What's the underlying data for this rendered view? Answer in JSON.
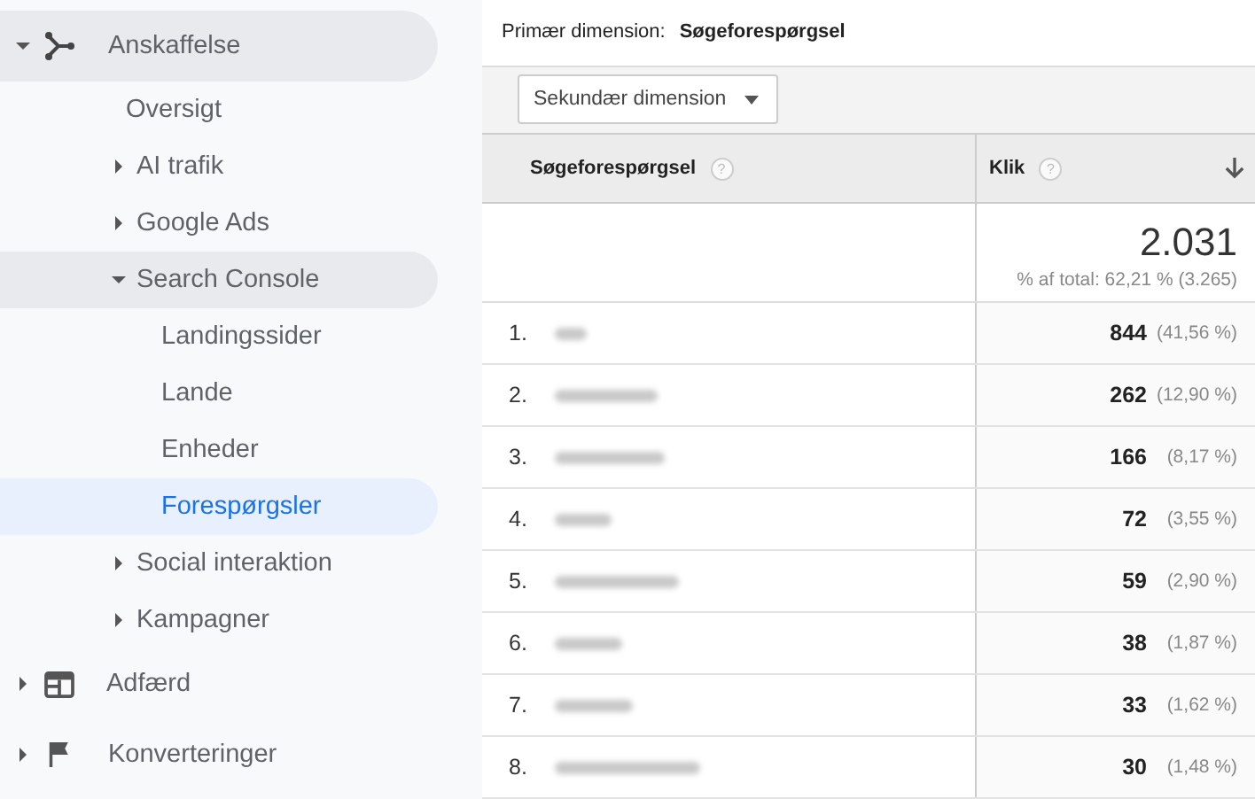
{
  "sidebar": {
    "items": [
      {
        "label": "Anskaffelse",
        "kind": "branch",
        "expanded": true,
        "highlighted": true,
        "selected": false,
        "children": [
          {
            "label": "Oversigt",
            "highlighted": false,
            "selected": false
          },
          {
            "label": "AI trafik",
            "expanded": false,
            "highlighted": false,
            "selected": false
          },
          {
            "label": "Google Ads",
            "expanded": false,
            "highlighted": false,
            "selected": false
          },
          {
            "label": "Search Console",
            "expanded": true,
            "highlighted": true,
            "selected": false,
            "children": [
              {
                "label": "Landingssider",
                "highlighted": false,
                "selected": false
              },
              {
                "label": "Lande",
                "highlighted": false,
                "selected": false
              },
              {
                "label": "Enheder",
                "highlighted": false,
                "selected": false
              },
              {
                "label": "Forespørgsler",
                "highlighted": false,
                "selected": true
              }
            ]
          },
          {
            "label": "Social interaktion",
            "expanded": false,
            "highlighted": false,
            "selected": false
          },
          {
            "label": "Kampagner",
            "expanded": false,
            "highlighted": false,
            "selected": false
          }
        ]
      },
      {
        "label": "Adfærd",
        "kind": "layout",
        "expanded": false,
        "highlighted": false,
        "selected": false
      },
      {
        "label": "Konverteringer",
        "kind": "flag",
        "expanded": false,
        "highlighted": false,
        "selected": false
      }
    ]
  },
  "report": {
    "primary_dimension_label": "Primær dimension:",
    "primary_dimension": "Søgeforespørgsel",
    "secondary_dimension_button": "Sekundær dimension",
    "table": {
      "columns": [
        {
          "label": "Søgeforespørgsel",
          "help": "?",
          "sorted": false
        },
        {
          "label": "Klik",
          "help": "?",
          "sorted": true
        }
      ],
      "total": {
        "value": "2.031",
        "share": "% af total: 62,21 % (3.265)"
      },
      "rows": [
        {
          "index": "1.",
          "clicks": "844",
          "share": "(41,56 %)"
        },
        {
          "index": "2.",
          "clicks": "262",
          "share": "(12,90 %)"
        },
        {
          "index": "3.",
          "clicks": "166",
          "share": "(8,17 %)"
        },
        {
          "index": "4.",
          "clicks": "72",
          "share": "(3,55 %)"
        },
        {
          "index": "5.",
          "clicks": "59",
          "share": "(2,90 %)"
        },
        {
          "index": "6.",
          "clicks": "38",
          "share": "(1,87 %)"
        },
        {
          "index": "7.",
          "clicks": "33",
          "share": "(1,62 %)"
        },
        {
          "index": "8.",
          "clicks": "30",
          "share": "(1,48 %)"
        }
      ]
    }
  }
}
